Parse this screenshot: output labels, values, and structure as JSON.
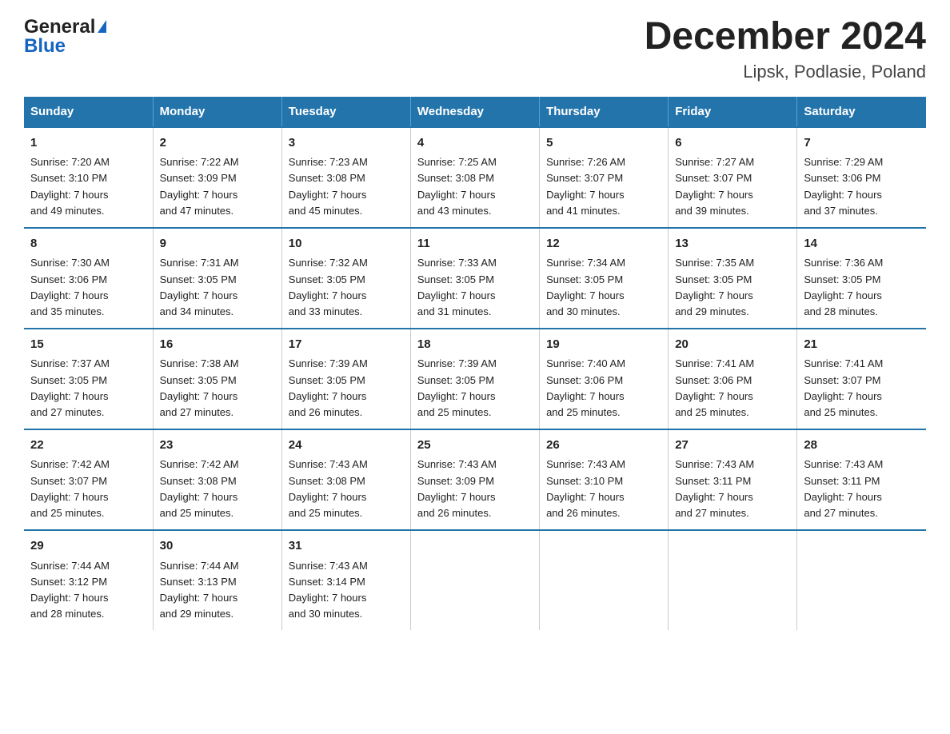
{
  "header": {
    "logo_general": "General",
    "logo_blue": "Blue",
    "title": "December 2024",
    "subtitle": "Lipsk, Podlasie, Poland"
  },
  "columns": [
    "Sunday",
    "Monday",
    "Tuesday",
    "Wednesday",
    "Thursday",
    "Friday",
    "Saturday"
  ],
  "weeks": [
    [
      {
        "day": "1",
        "info": "Sunrise: 7:20 AM\nSunset: 3:10 PM\nDaylight: 7 hours\nand 49 minutes."
      },
      {
        "day": "2",
        "info": "Sunrise: 7:22 AM\nSunset: 3:09 PM\nDaylight: 7 hours\nand 47 minutes."
      },
      {
        "day": "3",
        "info": "Sunrise: 7:23 AM\nSunset: 3:08 PM\nDaylight: 7 hours\nand 45 minutes."
      },
      {
        "day": "4",
        "info": "Sunrise: 7:25 AM\nSunset: 3:08 PM\nDaylight: 7 hours\nand 43 minutes."
      },
      {
        "day": "5",
        "info": "Sunrise: 7:26 AM\nSunset: 3:07 PM\nDaylight: 7 hours\nand 41 minutes."
      },
      {
        "day": "6",
        "info": "Sunrise: 7:27 AM\nSunset: 3:07 PM\nDaylight: 7 hours\nand 39 minutes."
      },
      {
        "day": "7",
        "info": "Sunrise: 7:29 AM\nSunset: 3:06 PM\nDaylight: 7 hours\nand 37 minutes."
      }
    ],
    [
      {
        "day": "8",
        "info": "Sunrise: 7:30 AM\nSunset: 3:06 PM\nDaylight: 7 hours\nand 35 minutes."
      },
      {
        "day": "9",
        "info": "Sunrise: 7:31 AM\nSunset: 3:05 PM\nDaylight: 7 hours\nand 34 minutes."
      },
      {
        "day": "10",
        "info": "Sunrise: 7:32 AM\nSunset: 3:05 PM\nDaylight: 7 hours\nand 33 minutes."
      },
      {
        "day": "11",
        "info": "Sunrise: 7:33 AM\nSunset: 3:05 PM\nDaylight: 7 hours\nand 31 minutes."
      },
      {
        "day": "12",
        "info": "Sunrise: 7:34 AM\nSunset: 3:05 PM\nDaylight: 7 hours\nand 30 minutes."
      },
      {
        "day": "13",
        "info": "Sunrise: 7:35 AM\nSunset: 3:05 PM\nDaylight: 7 hours\nand 29 minutes."
      },
      {
        "day": "14",
        "info": "Sunrise: 7:36 AM\nSunset: 3:05 PM\nDaylight: 7 hours\nand 28 minutes."
      }
    ],
    [
      {
        "day": "15",
        "info": "Sunrise: 7:37 AM\nSunset: 3:05 PM\nDaylight: 7 hours\nand 27 minutes."
      },
      {
        "day": "16",
        "info": "Sunrise: 7:38 AM\nSunset: 3:05 PM\nDaylight: 7 hours\nand 27 minutes."
      },
      {
        "day": "17",
        "info": "Sunrise: 7:39 AM\nSunset: 3:05 PM\nDaylight: 7 hours\nand 26 minutes."
      },
      {
        "day": "18",
        "info": "Sunrise: 7:39 AM\nSunset: 3:05 PM\nDaylight: 7 hours\nand 25 minutes."
      },
      {
        "day": "19",
        "info": "Sunrise: 7:40 AM\nSunset: 3:06 PM\nDaylight: 7 hours\nand 25 minutes."
      },
      {
        "day": "20",
        "info": "Sunrise: 7:41 AM\nSunset: 3:06 PM\nDaylight: 7 hours\nand 25 minutes."
      },
      {
        "day": "21",
        "info": "Sunrise: 7:41 AM\nSunset: 3:07 PM\nDaylight: 7 hours\nand 25 minutes."
      }
    ],
    [
      {
        "day": "22",
        "info": "Sunrise: 7:42 AM\nSunset: 3:07 PM\nDaylight: 7 hours\nand 25 minutes."
      },
      {
        "day": "23",
        "info": "Sunrise: 7:42 AM\nSunset: 3:08 PM\nDaylight: 7 hours\nand 25 minutes."
      },
      {
        "day": "24",
        "info": "Sunrise: 7:43 AM\nSunset: 3:08 PM\nDaylight: 7 hours\nand 25 minutes."
      },
      {
        "day": "25",
        "info": "Sunrise: 7:43 AM\nSunset: 3:09 PM\nDaylight: 7 hours\nand 26 minutes."
      },
      {
        "day": "26",
        "info": "Sunrise: 7:43 AM\nSunset: 3:10 PM\nDaylight: 7 hours\nand 26 minutes."
      },
      {
        "day": "27",
        "info": "Sunrise: 7:43 AM\nSunset: 3:11 PM\nDaylight: 7 hours\nand 27 minutes."
      },
      {
        "day": "28",
        "info": "Sunrise: 7:43 AM\nSunset: 3:11 PM\nDaylight: 7 hours\nand 27 minutes."
      }
    ],
    [
      {
        "day": "29",
        "info": "Sunrise: 7:44 AM\nSunset: 3:12 PM\nDaylight: 7 hours\nand 28 minutes."
      },
      {
        "day": "30",
        "info": "Sunrise: 7:44 AM\nSunset: 3:13 PM\nDaylight: 7 hours\nand 29 minutes."
      },
      {
        "day": "31",
        "info": "Sunrise: 7:43 AM\nSunset: 3:14 PM\nDaylight: 7 hours\nand 30 minutes."
      },
      {
        "day": "",
        "info": ""
      },
      {
        "day": "",
        "info": ""
      },
      {
        "day": "",
        "info": ""
      },
      {
        "day": "",
        "info": ""
      }
    ]
  ]
}
